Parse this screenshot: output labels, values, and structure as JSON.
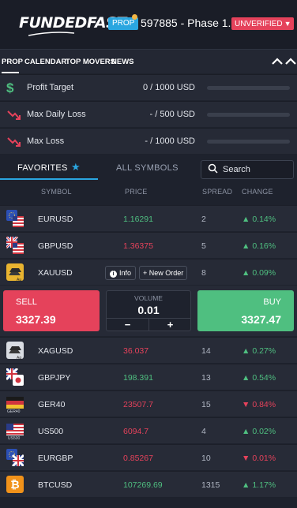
{
  "header": {
    "logo_text_1": "FUNDED",
    "logo_text_2": "FAST",
    "prop_badge": "PROP",
    "account_text": "597885 - Phase 1...",
    "unverified": "UNVERIFIED"
  },
  "nav": {
    "items": [
      "PROP",
      "CALENDAR",
      "TOP MOVERS",
      "NEWS"
    ]
  },
  "stats": [
    {
      "label": "Profit Target",
      "value": "0 / 1000 USD",
      "icon": "dollar-icon"
    },
    {
      "label": "Max Daily Loss",
      "value": "- / 500 USD",
      "icon": "trend-down-icon"
    },
    {
      "label": "Max Loss",
      "value": "- / 1000 USD",
      "icon": "trend-down-icon"
    }
  ],
  "tabs": {
    "favorites": "FAVORITES",
    "all_symbols": "ALL SYMBOLS",
    "search_placeholder": "Search"
  },
  "columns": {
    "symbol": "SYMBOL",
    "price": "PRICE",
    "spread": "SPREAD",
    "change": "CHANGE"
  },
  "rows": [
    {
      "symbol": "EURUSD",
      "price": "1.16291",
      "price_dir": "up",
      "spread": "2",
      "change": "0.14%",
      "change_dir": "up"
    },
    {
      "symbol": "GBPUSD",
      "price": "1.36375",
      "price_dir": "down",
      "spread": "5",
      "change": "0.16%",
      "change_dir": "up"
    },
    {
      "symbol": "XAUUSD",
      "price": "",
      "spread": "8",
      "change": "0.09%",
      "change_dir": "up"
    },
    {
      "symbol": "XAGUSD",
      "price": "36.037",
      "price_dir": "down",
      "spread": "14",
      "change": "0.27%",
      "change_dir": "up"
    },
    {
      "symbol": "GBPJPY",
      "price": "198.391",
      "price_dir": "up",
      "spread": "13",
      "change": "0.54%",
      "change_dir": "up"
    },
    {
      "symbol": "GER40",
      "price": "23507.7",
      "price_dir": "down",
      "spread": "15",
      "change": "0.84%",
      "change_dir": "down"
    },
    {
      "symbol": "US500",
      "price": "6094.7",
      "price_dir": "down",
      "spread": "4",
      "change": "0.02%",
      "change_dir": "up"
    },
    {
      "symbol": "EURGBP",
      "price": "0.85267",
      "price_dir": "down",
      "spread": "10",
      "change": "0.01%",
      "change_dir": "down"
    },
    {
      "symbol": "BTCUSD",
      "price": "107269.69",
      "price_dir": "up",
      "spread": "1315",
      "change": "1.17%",
      "change_dir": "up"
    }
  ],
  "xau_actions": {
    "info": "Info",
    "new_order": "New Order"
  },
  "trade": {
    "sell_label": "SELL",
    "sell_price": "3327.39",
    "buy_label": "BUY",
    "buy_price": "3327.47",
    "volume_label": "VOLUME",
    "volume_value": "0.01",
    "minus": "−",
    "plus": "+"
  },
  "flag_labels": {
    "xau": "Au",
    "xag": "Ag",
    "ger": "GER40",
    "us": "US500"
  },
  "colors": {
    "accent": "#2aa6e0",
    "up": "#4fbf80",
    "down": "#e5425b",
    "bg": "#1e222d"
  }
}
